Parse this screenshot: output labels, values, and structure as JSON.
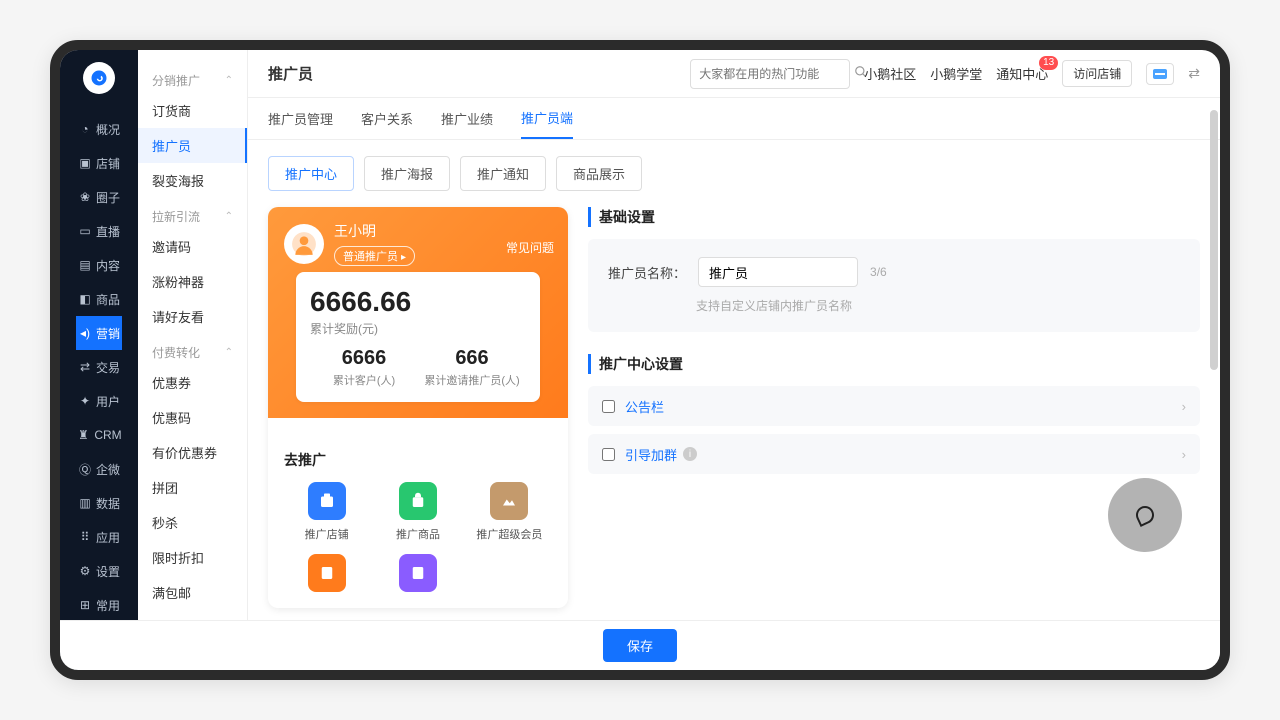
{
  "header": {
    "title": "推广员",
    "search_placeholder": "大家都在用的热门功能",
    "links": [
      "小鹅社区",
      "小鹅学堂",
      "通知中心"
    ],
    "badge": "13",
    "visit_btn": "访问店铺"
  },
  "left_nav": [
    {
      "icon": "overview",
      "label": "概况"
    },
    {
      "icon": "shop",
      "label": "店铺"
    },
    {
      "icon": "circle",
      "label": "圈子"
    },
    {
      "icon": "live",
      "label": "直播"
    },
    {
      "icon": "content",
      "label": "内容"
    },
    {
      "icon": "goods",
      "label": "商品"
    },
    {
      "icon": "marketing",
      "label": "营销",
      "active": true
    },
    {
      "icon": "trade",
      "label": "交易"
    },
    {
      "icon": "user",
      "label": "用户"
    },
    {
      "icon": "crm",
      "label": "CRM"
    },
    {
      "icon": "wecom",
      "label": "企微"
    },
    {
      "icon": "data",
      "label": "数据"
    },
    {
      "icon": "apps",
      "label": "应用"
    },
    {
      "icon": "settings",
      "label": "设置"
    },
    {
      "icon": "common",
      "label": "常用"
    }
  ],
  "sub_nav": {
    "groups": [
      {
        "title": "分销推广",
        "items": [
          "订货商",
          "推广员",
          "裂变海报"
        ],
        "active": "推广员"
      },
      {
        "title": "拉新引流",
        "items": [
          "邀请码",
          "涨粉神器",
          "请好友看"
        ]
      },
      {
        "title": "付费转化",
        "items": [
          "优惠券",
          "优惠码",
          "有价优惠券",
          "拼团",
          "秒杀",
          "限时折扣",
          "满包邮"
        ]
      }
    ]
  },
  "tabs_main": [
    "推广员管理",
    "客户关系",
    "推广业绩",
    "推广员端"
  ],
  "tabs_main_active": "推广员端",
  "tabs_sub": [
    "推广中心",
    "推广海报",
    "推广通知",
    "商品展示"
  ],
  "tabs_sub_active": "推广中心",
  "phone": {
    "user_name": "王小明",
    "role_tag": "普通推广员",
    "faq": "常见问题",
    "total": "6666.66",
    "total_label": "累计奖励(元)",
    "stat1_n": "6666",
    "stat1_l": "累计客户(人)",
    "stat2_n": "666",
    "stat2_l": "累计邀请推广员(人)",
    "promo_title": "去推广",
    "grid": [
      {
        "label": "推广店铺",
        "color": "#2e7dff"
      },
      {
        "label": "推广商品",
        "color": "#28c76f"
      },
      {
        "label": "推广超级会员",
        "color": "#c49a6c"
      },
      {
        "label": "",
        "color": "#ff7b1c"
      },
      {
        "label": "",
        "color": "#8a5cff"
      }
    ]
  },
  "settings": {
    "basic_title": "基础设置",
    "name_label": "推广员名称：",
    "name_value": "推广员",
    "name_count": "3/6",
    "name_tip": "支持自定义店铺内推广员名称",
    "center_title": "推广中心设置",
    "rows": [
      {
        "label": "公告栏",
        "info": false
      },
      {
        "label": "引导加群",
        "info": true
      }
    ]
  },
  "save_btn": "保存"
}
